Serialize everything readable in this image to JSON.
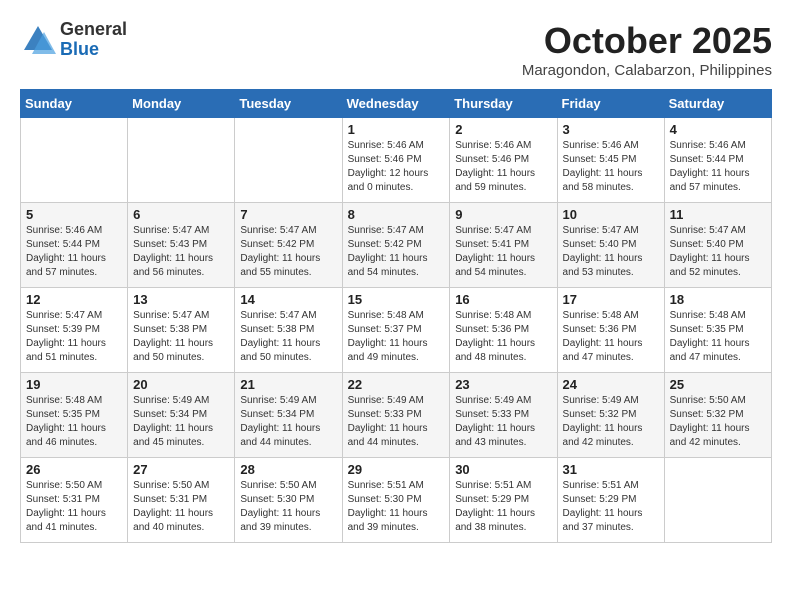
{
  "header": {
    "logo_general": "General",
    "logo_blue": "Blue",
    "month_title": "October 2025",
    "location": "Maragondon, Calabarzon, Philippines"
  },
  "weekdays": [
    "Sunday",
    "Monday",
    "Tuesday",
    "Wednesday",
    "Thursday",
    "Friday",
    "Saturday"
  ],
  "weeks": [
    [
      {
        "day": "",
        "info": ""
      },
      {
        "day": "",
        "info": ""
      },
      {
        "day": "",
        "info": ""
      },
      {
        "day": "1",
        "info": "Sunrise: 5:46 AM\nSunset: 5:46 PM\nDaylight: 12 hours\nand 0 minutes."
      },
      {
        "day": "2",
        "info": "Sunrise: 5:46 AM\nSunset: 5:46 PM\nDaylight: 11 hours\nand 59 minutes."
      },
      {
        "day": "3",
        "info": "Sunrise: 5:46 AM\nSunset: 5:45 PM\nDaylight: 11 hours\nand 58 minutes."
      },
      {
        "day": "4",
        "info": "Sunrise: 5:46 AM\nSunset: 5:44 PM\nDaylight: 11 hours\nand 57 minutes."
      }
    ],
    [
      {
        "day": "5",
        "info": "Sunrise: 5:46 AM\nSunset: 5:44 PM\nDaylight: 11 hours\nand 57 minutes."
      },
      {
        "day": "6",
        "info": "Sunrise: 5:47 AM\nSunset: 5:43 PM\nDaylight: 11 hours\nand 56 minutes."
      },
      {
        "day": "7",
        "info": "Sunrise: 5:47 AM\nSunset: 5:42 PM\nDaylight: 11 hours\nand 55 minutes."
      },
      {
        "day": "8",
        "info": "Sunrise: 5:47 AM\nSunset: 5:42 PM\nDaylight: 11 hours\nand 54 minutes."
      },
      {
        "day": "9",
        "info": "Sunrise: 5:47 AM\nSunset: 5:41 PM\nDaylight: 11 hours\nand 54 minutes."
      },
      {
        "day": "10",
        "info": "Sunrise: 5:47 AM\nSunset: 5:40 PM\nDaylight: 11 hours\nand 53 minutes."
      },
      {
        "day": "11",
        "info": "Sunrise: 5:47 AM\nSunset: 5:40 PM\nDaylight: 11 hours\nand 52 minutes."
      }
    ],
    [
      {
        "day": "12",
        "info": "Sunrise: 5:47 AM\nSunset: 5:39 PM\nDaylight: 11 hours\nand 51 minutes."
      },
      {
        "day": "13",
        "info": "Sunrise: 5:47 AM\nSunset: 5:38 PM\nDaylight: 11 hours\nand 50 minutes."
      },
      {
        "day": "14",
        "info": "Sunrise: 5:47 AM\nSunset: 5:38 PM\nDaylight: 11 hours\nand 50 minutes."
      },
      {
        "day": "15",
        "info": "Sunrise: 5:48 AM\nSunset: 5:37 PM\nDaylight: 11 hours\nand 49 minutes."
      },
      {
        "day": "16",
        "info": "Sunrise: 5:48 AM\nSunset: 5:36 PM\nDaylight: 11 hours\nand 48 minutes."
      },
      {
        "day": "17",
        "info": "Sunrise: 5:48 AM\nSunset: 5:36 PM\nDaylight: 11 hours\nand 47 minutes."
      },
      {
        "day": "18",
        "info": "Sunrise: 5:48 AM\nSunset: 5:35 PM\nDaylight: 11 hours\nand 47 minutes."
      }
    ],
    [
      {
        "day": "19",
        "info": "Sunrise: 5:48 AM\nSunset: 5:35 PM\nDaylight: 11 hours\nand 46 minutes."
      },
      {
        "day": "20",
        "info": "Sunrise: 5:49 AM\nSunset: 5:34 PM\nDaylight: 11 hours\nand 45 minutes."
      },
      {
        "day": "21",
        "info": "Sunrise: 5:49 AM\nSunset: 5:34 PM\nDaylight: 11 hours\nand 44 minutes."
      },
      {
        "day": "22",
        "info": "Sunrise: 5:49 AM\nSunset: 5:33 PM\nDaylight: 11 hours\nand 44 minutes."
      },
      {
        "day": "23",
        "info": "Sunrise: 5:49 AM\nSunset: 5:33 PM\nDaylight: 11 hours\nand 43 minutes."
      },
      {
        "day": "24",
        "info": "Sunrise: 5:49 AM\nSunset: 5:32 PM\nDaylight: 11 hours\nand 42 minutes."
      },
      {
        "day": "25",
        "info": "Sunrise: 5:50 AM\nSunset: 5:32 PM\nDaylight: 11 hours\nand 42 minutes."
      }
    ],
    [
      {
        "day": "26",
        "info": "Sunrise: 5:50 AM\nSunset: 5:31 PM\nDaylight: 11 hours\nand 41 minutes."
      },
      {
        "day": "27",
        "info": "Sunrise: 5:50 AM\nSunset: 5:31 PM\nDaylight: 11 hours\nand 40 minutes."
      },
      {
        "day": "28",
        "info": "Sunrise: 5:50 AM\nSunset: 5:30 PM\nDaylight: 11 hours\nand 39 minutes."
      },
      {
        "day": "29",
        "info": "Sunrise: 5:51 AM\nSunset: 5:30 PM\nDaylight: 11 hours\nand 39 minutes."
      },
      {
        "day": "30",
        "info": "Sunrise: 5:51 AM\nSunset: 5:29 PM\nDaylight: 11 hours\nand 38 minutes."
      },
      {
        "day": "31",
        "info": "Sunrise: 5:51 AM\nSunset: 5:29 PM\nDaylight: 11 hours\nand 37 minutes."
      },
      {
        "day": "",
        "info": ""
      }
    ]
  ]
}
